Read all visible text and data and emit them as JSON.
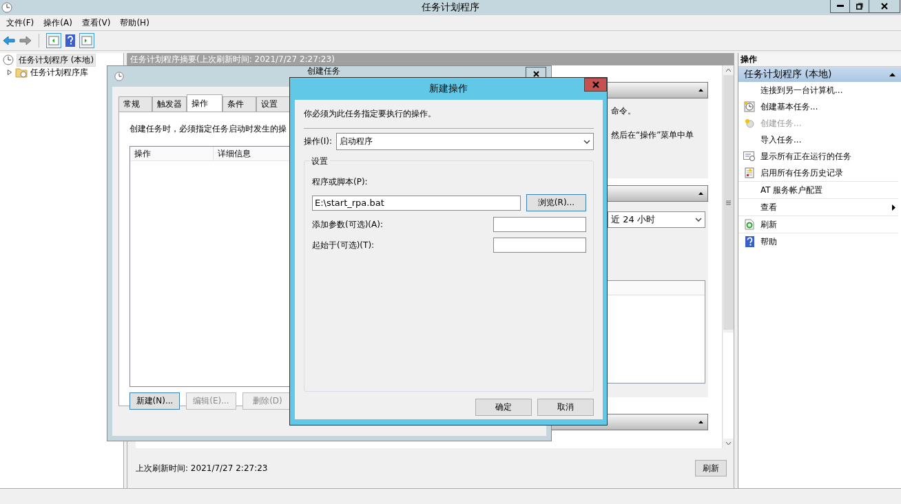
{
  "window": {
    "title": "任务计划程序"
  },
  "menu": [
    "文件(F)",
    "操作(A)",
    "查看(V)",
    "帮助(H)"
  ],
  "tree": [
    {
      "label": "任务计划程序 (本地)",
      "selected": true,
      "children": [
        {
          "label": "任务计划程序库",
          "selected": false,
          "expanded": false
        }
      ]
    }
  ],
  "summary": {
    "header": "任务计划程序摘要(上次刷新时间: 2021/7/27 2:27:23)",
    "fragments": [
      "命令。",
      "然后在“操作”菜单中单"
    ],
    "range": "近 24 小时",
    "last_refresh": "上次刷新时间: 2021/7/27 2:27:23",
    "refresh_button": "刷新"
  },
  "create_task": {
    "title": "创建任务",
    "tabs": [
      {
        "label": "常规",
        "selected": false
      },
      {
        "label": "触发器",
        "selected": false
      },
      {
        "label": "操作",
        "selected": true
      },
      {
        "label": "条件",
        "selected": false
      },
      {
        "label": "设置",
        "selected": false
      }
    ],
    "description": "创建任务时，必须指定任务启动时发生的操",
    "columns": [
      "操作",
      "详细信息"
    ],
    "buttons": [
      {
        "label": "新建(N)...",
        "disabled": false
      },
      {
        "label": "编辑(E)...",
        "disabled": true
      },
      {
        "label": "删除(D)",
        "disabled": true
      }
    ]
  },
  "new_action": {
    "title": "新建操作",
    "instruction": "你必须为此任务指定要执行的操作。",
    "action_label": "操作(I):",
    "action_value": "启动程序",
    "group": "设置",
    "program_label": "程序或脚本(P):",
    "program_value": "E:\\start_rpa.bat",
    "browse": "浏览(R)...",
    "args_label": "添加参数(可选)(A):",
    "start_label": "起始于(可选)(T):",
    "ok": "确定",
    "cancel": "取消"
  },
  "actions": {
    "header": "操作",
    "section": "任务计划程序 (本地)",
    "items": [
      {
        "label": "连接到另一台计算机...",
        "disabled": false,
        "divider": false,
        "submenu": false
      },
      {
        "label": "创建基本任务...",
        "disabled": false,
        "divider": false,
        "submenu": false
      },
      {
        "label": "创建任务...",
        "disabled": true,
        "divider": false,
        "submenu": false
      },
      {
        "label": "导入任务...",
        "disabled": false,
        "divider": false,
        "submenu": false
      },
      {
        "label": "显示所有正在运行的任务",
        "disabled": false,
        "divider": false,
        "submenu": false
      },
      {
        "label": "启用所有任务历史记录",
        "disabled": false,
        "divider": true,
        "submenu": false
      },
      {
        "label": "AT 服务帐户配置",
        "disabled": false,
        "divider": true,
        "submenu": false
      },
      {
        "label": "查看",
        "disabled": false,
        "divider": true,
        "submenu": true
      },
      {
        "label": "刷新",
        "disabled": false,
        "divider": true,
        "submenu": false
      },
      {
        "label": "帮助",
        "disabled": false,
        "divider": false,
        "submenu": false
      }
    ]
  }
}
